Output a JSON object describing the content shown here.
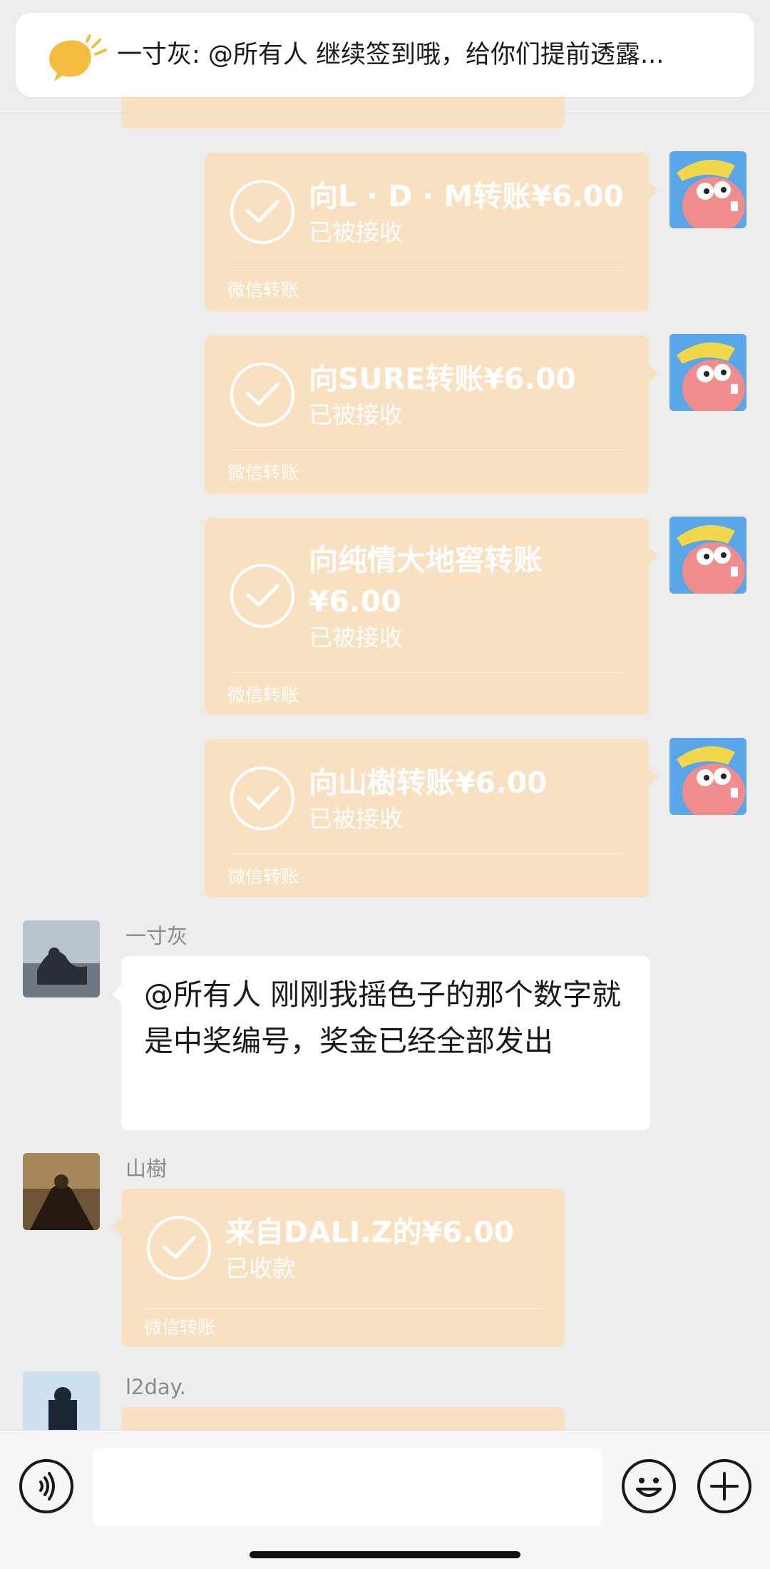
{
  "notice": {
    "text": "一寸灰: @所有人 继续签到哦，给你们提前透露..."
  },
  "messages": {
    "transfers_sent": [
      {
        "amount": "向L · D · M转账¥6.00",
        "status": "已被接收",
        "footer": "微信转账"
      },
      {
        "amount": "向SURE转账¥6.00",
        "status": "已被接收",
        "footer": "微信转账"
      },
      {
        "amount_line1": "向纯情大地窖转账",
        "amount_line2": "¥6.00",
        "status": "已被接收",
        "footer": "微信转账"
      },
      {
        "amount": "向山樹转账¥6.00",
        "status": "已被接收",
        "footer": "微信转账"
      }
    ],
    "group_notice": {
      "sender": "一寸灰",
      "text": "@所有人  刚刚我摇色子的那个数字就是中奖编号，奖金已经全部发出"
    },
    "received_transfer": {
      "sender": "山樹",
      "amount": "来自DALI.Z的¥6.00",
      "status": "已收款",
      "footer": "微信转账"
    },
    "last_sender": {
      "sender": "l2day."
    }
  },
  "input": {
    "placeholder": ""
  },
  "colors": {
    "transfer_card": "#f8e0c1",
    "background": "#ededed",
    "notice_icon": "#f5bd3f"
  }
}
